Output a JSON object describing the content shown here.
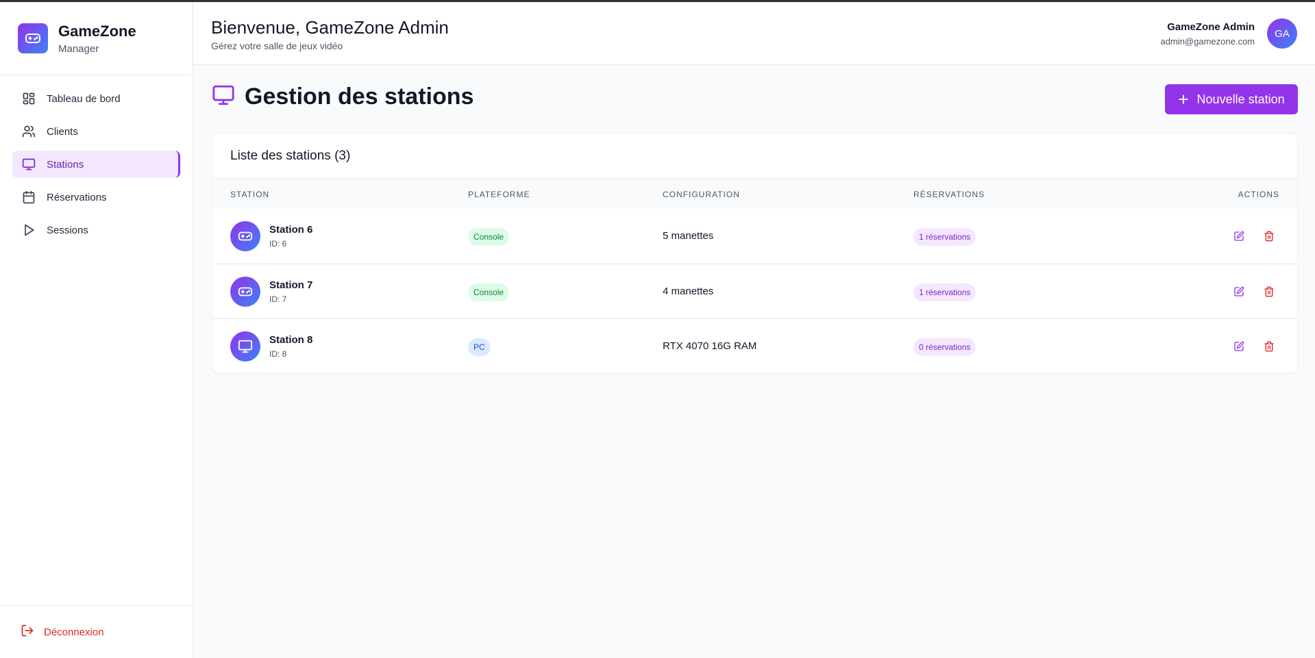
{
  "brand": {
    "name": "GameZone",
    "subtitle": "Manager",
    "icon": "gamepad-icon"
  },
  "sidebar": {
    "items": [
      {
        "label": "Tableau de bord",
        "icon": "dashboard-grid-icon",
        "active": false
      },
      {
        "label": "Clients",
        "icon": "users-icon",
        "active": false
      },
      {
        "label": "Stations",
        "icon": "monitor-icon",
        "active": true
      },
      {
        "label": "Réservations",
        "icon": "calendar-icon",
        "active": false
      },
      {
        "label": "Sessions",
        "icon": "play-icon",
        "active": false
      }
    ],
    "logout": {
      "label": "Déconnexion",
      "icon": "logout-icon"
    }
  },
  "header": {
    "title": "Bienvenue, GameZone Admin",
    "subtitle": "Gérez votre salle de jeux vidéo",
    "user_name": "GameZone Admin",
    "user_email": "admin@gamezone.com",
    "avatar_initials": "GA"
  },
  "page": {
    "title": "Gestion des stations",
    "title_icon": "monitor-icon",
    "new_button": "Nouvelle station"
  },
  "table": {
    "title": "Liste des stations (3)",
    "columns": [
      "STATION",
      "PLATEFORME",
      "CONFIGURATION",
      "RÉSERVATIONS",
      "ACTIONS"
    ],
    "rows": [
      {
        "name": "Station 6",
        "id": "ID: 6",
        "icon": "gamepad-icon",
        "platform": "Console",
        "config": "5 manettes",
        "reservations": "1 réservations"
      },
      {
        "name": "Station 7",
        "id": "ID: 7",
        "icon": "gamepad-icon",
        "platform": "Console",
        "config": "4 manettes",
        "reservations": "1 réservations"
      },
      {
        "name": "Station 8",
        "id": "ID: 8",
        "icon": "monitor-icon",
        "platform": "PC",
        "config": "RTX 4070 16G RAM",
        "reservations": "0 réservations"
      }
    ]
  },
  "colors": {
    "accent": "#9333ea",
    "gradient_end": "#3b82f6",
    "danger": "#dc2626",
    "console_badge": "#dcfce7",
    "pc_badge": "#dbeafe",
    "reservation_badge": "#f3e8ff"
  }
}
